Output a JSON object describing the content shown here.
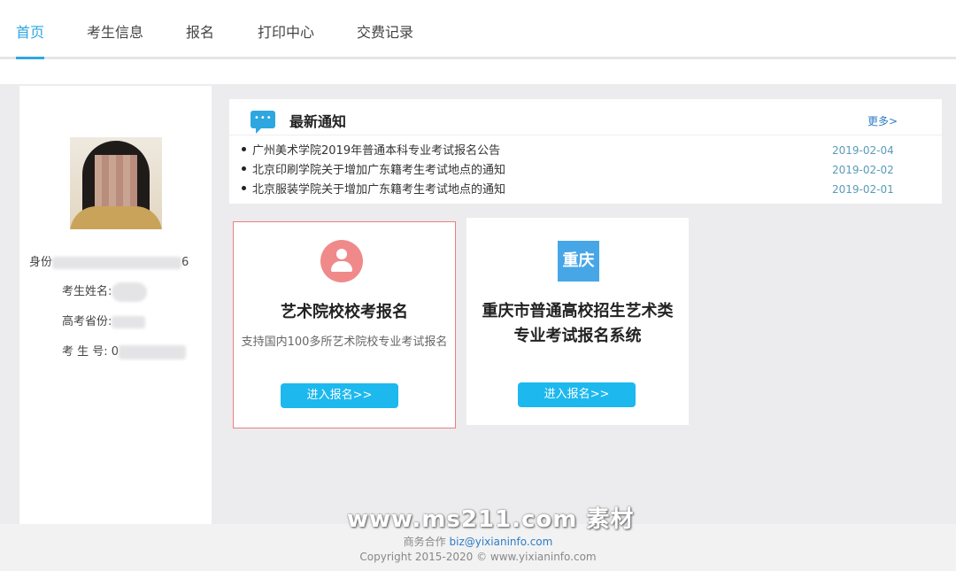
{
  "nav": {
    "items": [
      {
        "label": "首页",
        "active": true
      },
      {
        "label": "考生信息",
        "active": false
      },
      {
        "label": "报名",
        "active": false
      },
      {
        "label": "打印中心",
        "active": false
      },
      {
        "label": "交费记录",
        "active": false
      }
    ]
  },
  "profile": {
    "id_label": "身份",
    "id_tail": "6",
    "name_label": "考生姓名:",
    "province_label": "高考省份:",
    "exam_no_label": "考 生 号:",
    "exam_no_prefix": "0"
  },
  "notice": {
    "title": "最新通知",
    "more_label": "更多>",
    "items": [
      {
        "text": "广州美术学院2019年普通本科专业考试报名公告",
        "date": "2019-02-04"
      },
      {
        "text": "北京印刷学院关于增加广东籍考生考试地点的通知",
        "date": "2019-02-02"
      },
      {
        "text": "北京服装学院关于增加广东籍考生考试地点的通知",
        "date": "2019-02-01"
      }
    ]
  },
  "cards": [
    {
      "title": "艺术院校校考报名",
      "desc": "支持国内100多所艺术院校专业考试报名",
      "button": "进入报名>>",
      "icon": "person-icon",
      "accent": "#f08a8a"
    },
    {
      "title_line1": "重庆市普通高校招生艺术类",
      "title_line2": "专业考试报名系统",
      "badge": "重庆",
      "button": "进入报名>>",
      "accent": "#47a6e6"
    }
  ],
  "footer": {
    "partner_label": "商务合作",
    "partner_email": "biz@yixianinfo.com",
    "copyright": "Copyright 2015-2020 © www.yixianinfo.com",
    "watermark": "www.ms211.com 素材"
  },
  "colors": {
    "brand": "#2ea7e0",
    "button": "#1db8ee",
    "date": "#5a9bb8"
  }
}
